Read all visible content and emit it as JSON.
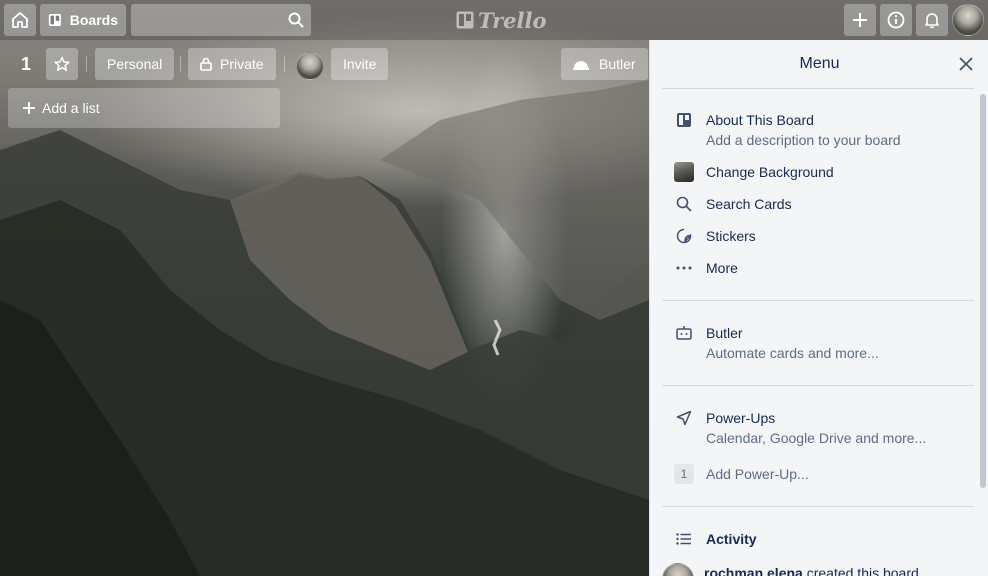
{
  "header": {
    "home_icon": "home-icon",
    "boards_label": "Boards",
    "search_placeholder": "",
    "logo_text": "Trello"
  },
  "board": {
    "name": "1",
    "team_label": "Personal",
    "visibility_label": "Private",
    "invite_label": "Invite",
    "butler_label": "Butler",
    "add_list_label": "Add a list"
  },
  "menu": {
    "title": "Menu",
    "about_title": "About This Board",
    "about_sub": "Add a description to your board",
    "change_bg": "Change Background",
    "search_cards": "Search Cards",
    "stickers": "Stickers",
    "more": "More",
    "butler_title": "Butler",
    "butler_sub": "Automate cards and more...",
    "powerups_title": "Power-Ups",
    "powerups_sub": "Calendar, Google Drive and more...",
    "powerup_count": "1",
    "add_powerup": "Add Power-Up...",
    "activity_title": "Activity",
    "activity_user": "rochman elena",
    "activity_action": " created this board"
  },
  "colors": {
    "menu_bg": "#f4f5f7",
    "text": "#172b4d",
    "subtext": "#5e6c84"
  }
}
